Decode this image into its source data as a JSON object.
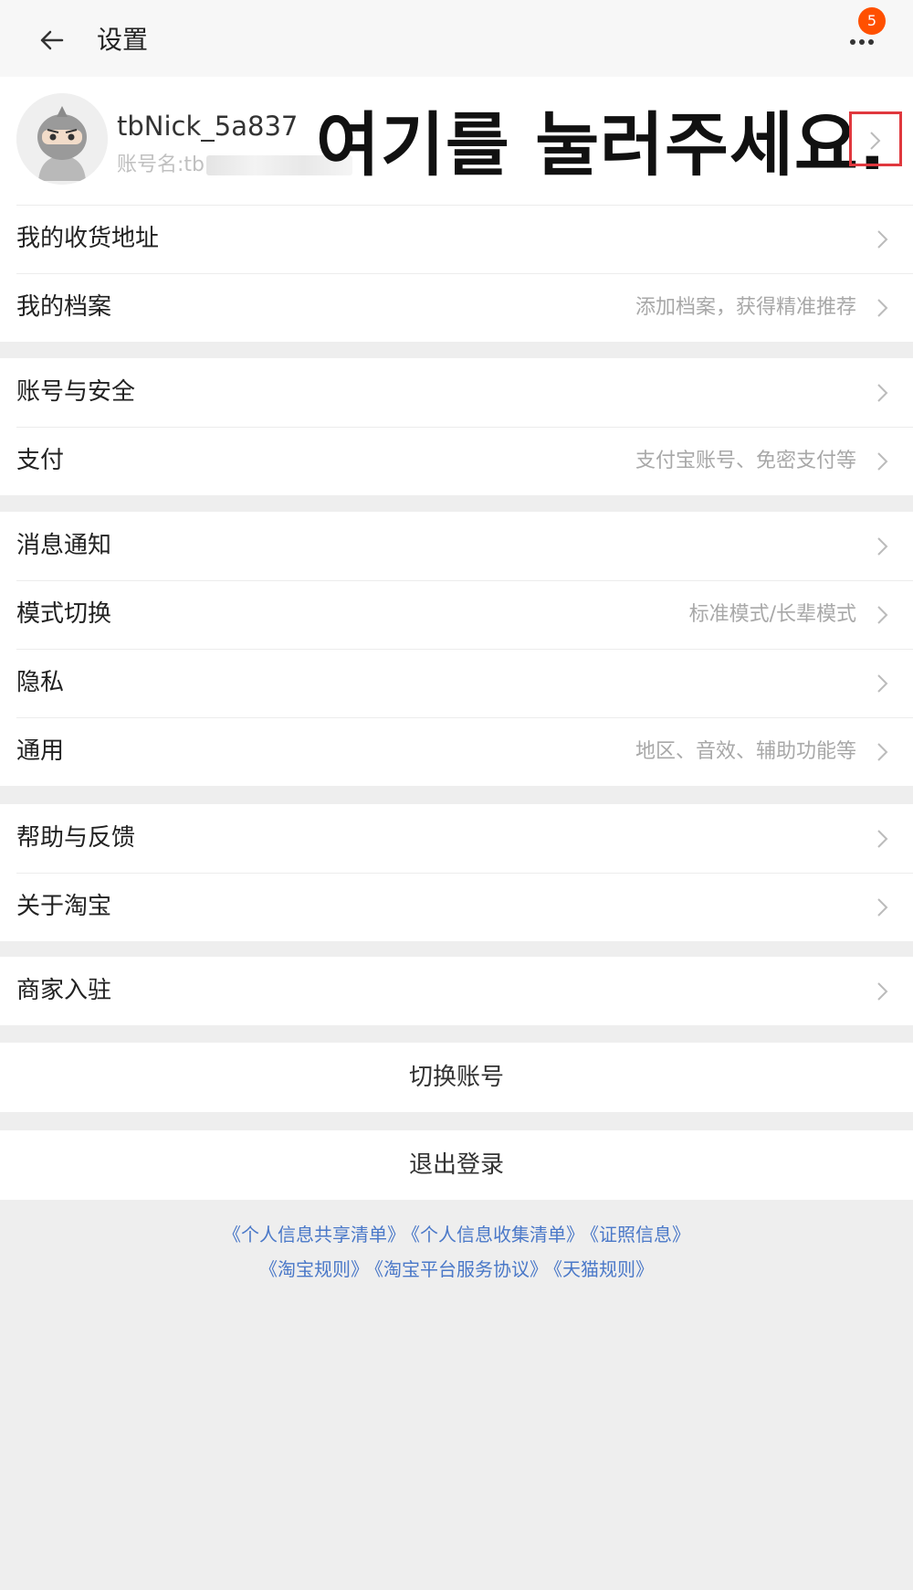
{
  "header": {
    "title": "设置",
    "badge_count": "5"
  },
  "profile": {
    "nickname": "tbNick_5a837",
    "account_prefix": "账号名:tb",
    "annotation": "여기를 눌러주세요."
  },
  "groups": [
    [
      {
        "label": "我的收货地址",
        "hint": ""
      },
      {
        "label": "我的档案",
        "hint": "添加档案，获得精准推荐"
      }
    ],
    [
      {
        "label": "账号与安全",
        "hint": ""
      },
      {
        "label": "支付",
        "hint": "支付宝账号、免密支付等"
      }
    ],
    [
      {
        "label": "消息通知",
        "hint": ""
      },
      {
        "label": "模式切换",
        "hint": "标准模式/长辈模式"
      },
      {
        "label": "隐私",
        "hint": ""
      },
      {
        "label": "通用",
        "hint": "地区、音效、辅助功能等"
      }
    ],
    [
      {
        "label": "帮助与反馈",
        "hint": ""
      },
      {
        "label": "关于淘宝",
        "hint": ""
      }
    ],
    [
      {
        "label": "商家入驻",
        "hint": ""
      }
    ]
  ],
  "switch_account": "切换账号",
  "logout": "退出登录",
  "footer_links": [
    [
      "《个人信息共享清单》",
      "《个人信息收集清单》",
      "《证照信息》"
    ],
    [
      "《淘宝规则》",
      "《淘宝平台服务协议》",
      "《天猫规则》"
    ]
  ],
  "colors": {
    "accent": "#ff5000",
    "link": "#4a78c8",
    "highlight": "#e0383e",
    "background": "#eeeeee"
  },
  "icons": {
    "back": "arrow-left",
    "more": "three-dots",
    "row": "chevron-right"
  }
}
